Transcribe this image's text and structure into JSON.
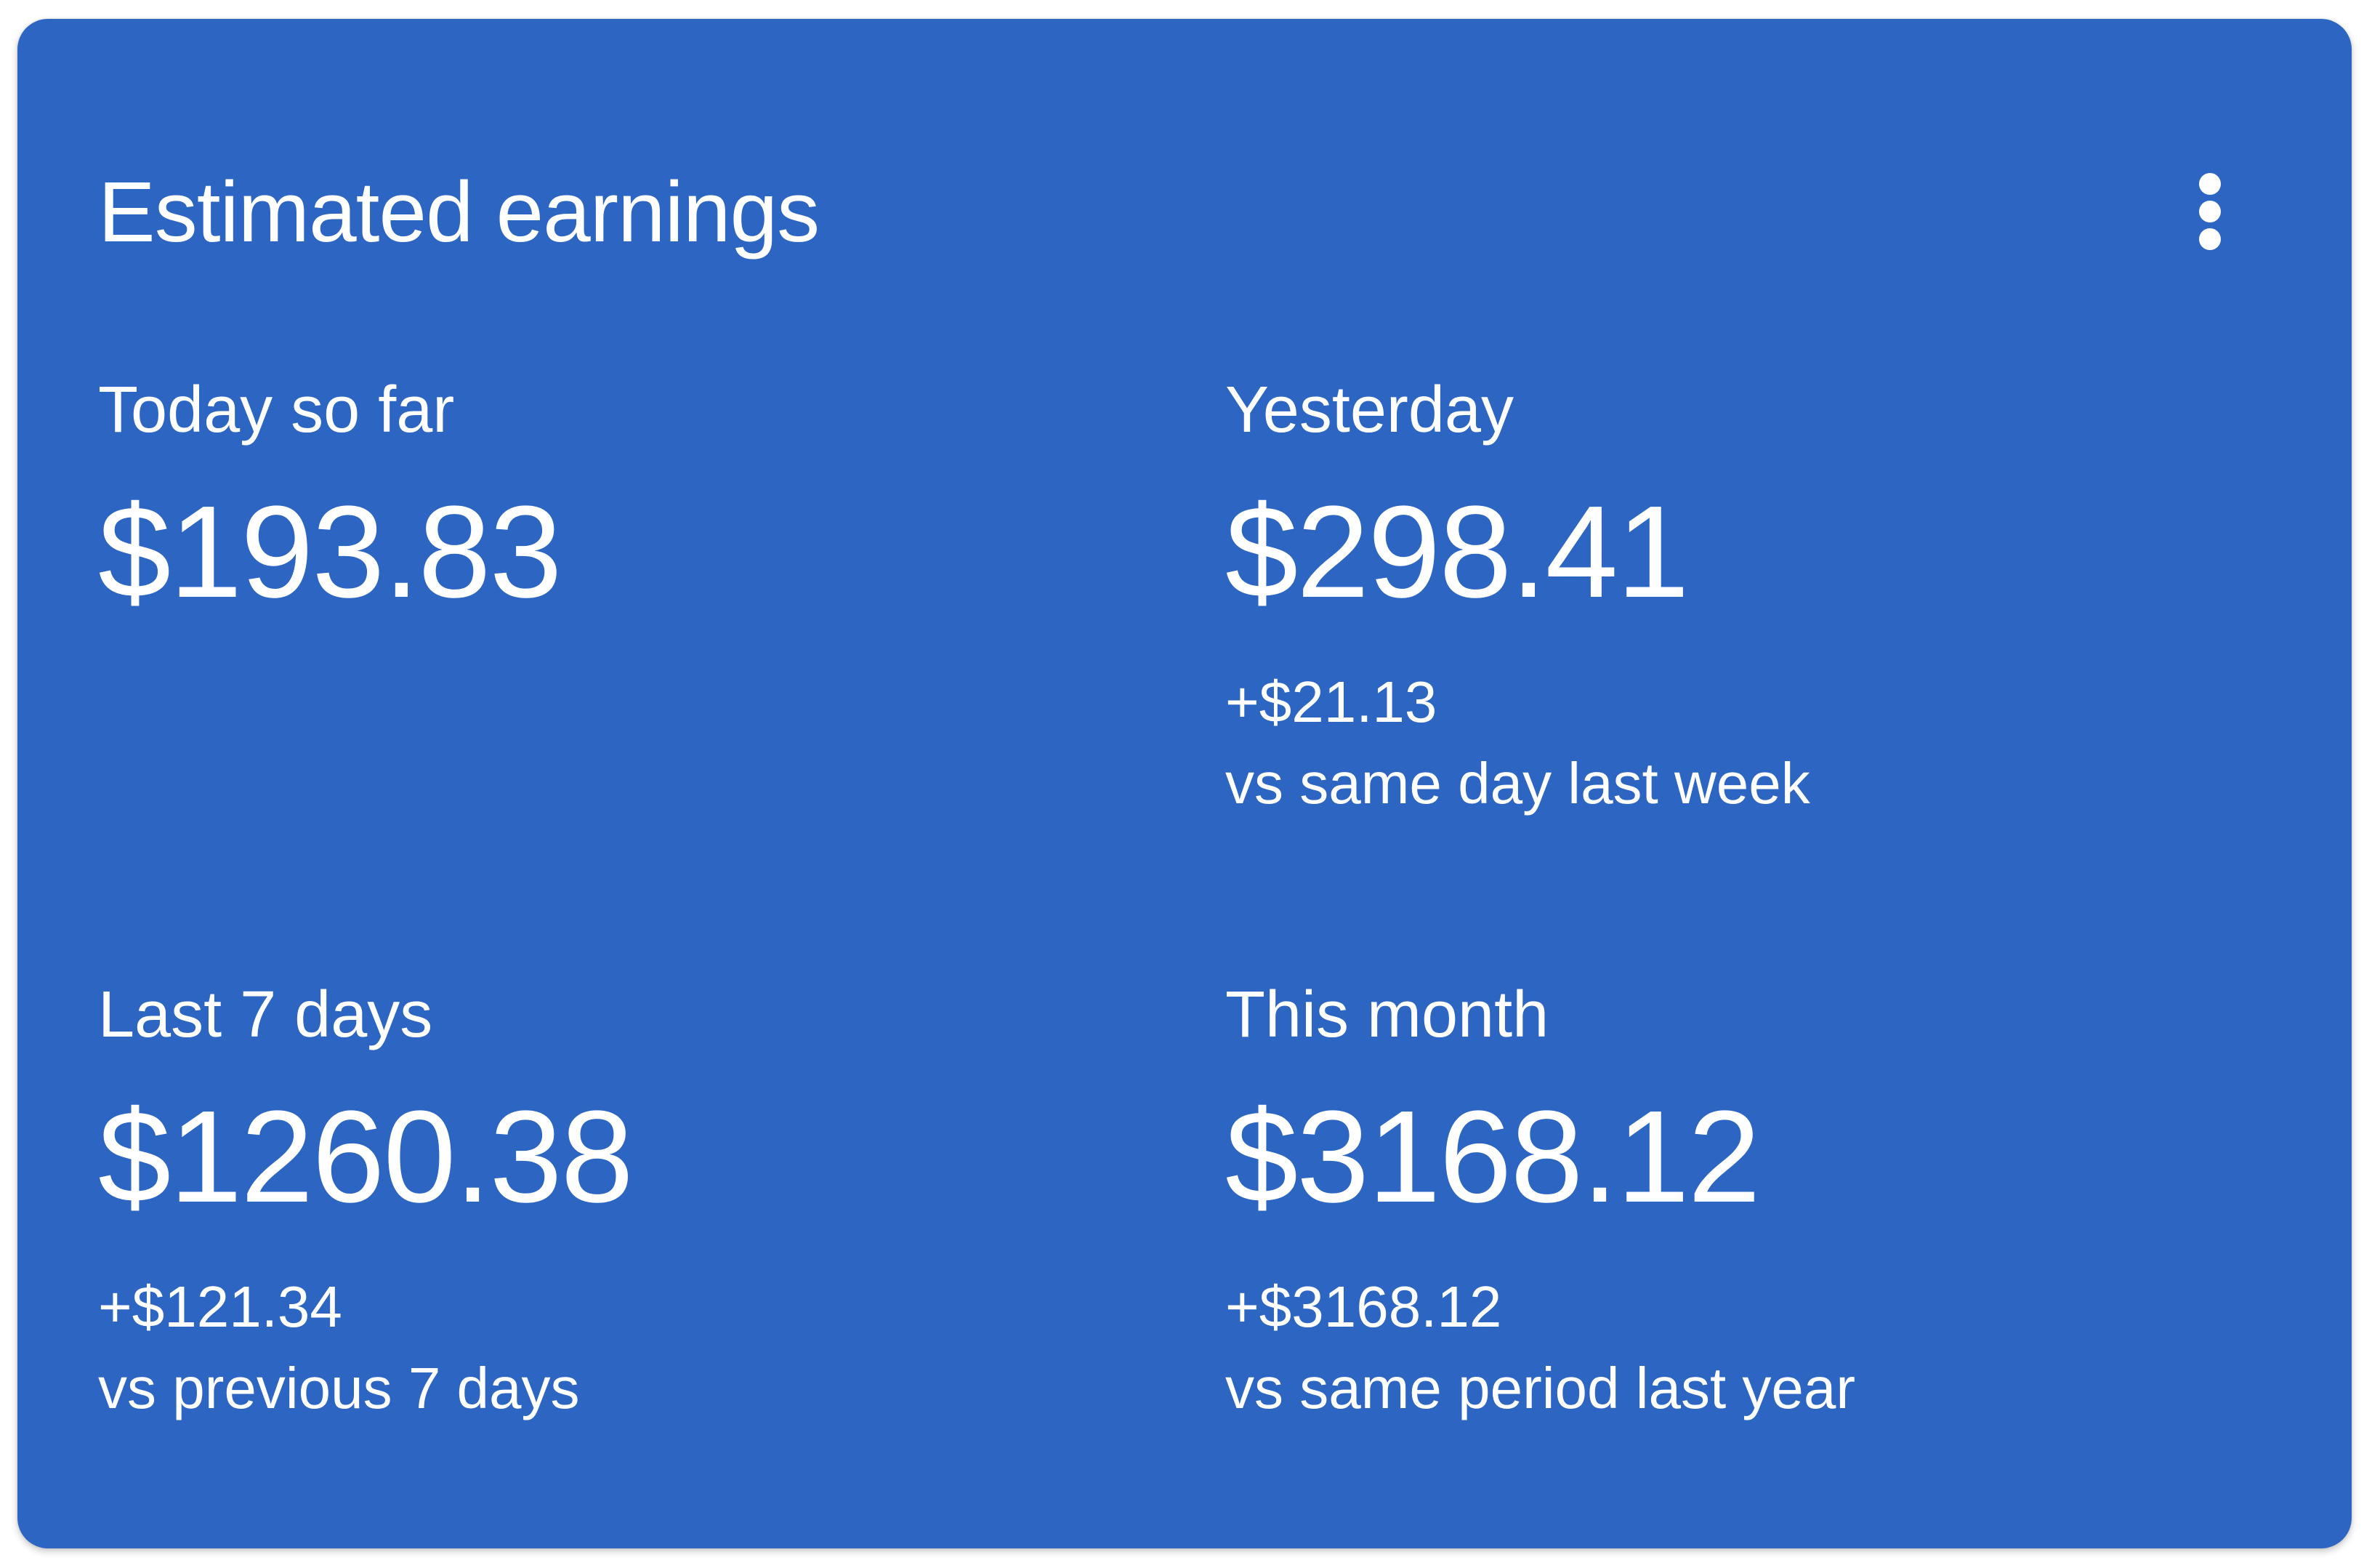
{
  "card": {
    "title": "Estimated earnings",
    "menu_icon": "more-vert-icon",
    "background_color": "#2d65c3",
    "text_color": "#ffffff"
  },
  "metrics": [
    {
      "label": "Today so far",
      "value": "$193.83"
    },
    {
      "label": "Yesterday",
      "value": "$298.41",
      "delta": "+$21.13",
      "comparison": "vs same day last week"
    },
    {
      "label": "Last 7 days",
      "value": "$1260.38",
      "delta": "+$121.34",
      "comparison": "vs previous 7 days"
    },
    {
      "label": "This month",
      "value": "$3168.12",
      "delta": "+$3168.12",
      "comparison": "vs same period last year"
    }
  ]
}
